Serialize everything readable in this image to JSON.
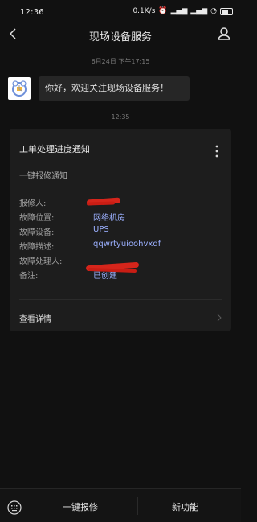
{
  "status_bar": {
    "time": "12:36",
    "network_speed": "0.1K/s",
    "icons": [
      "alarm-icon",
      "signal-icon",
      "signal-icon",
      "wifi-icon",
      "battery-icon"
    ]
  },
  "header": {
    "title": "现场设备服务",
    "back_icon": "back-icon",
    "profile_icon": "profile-icon"
  },
  "chat": {
    "timestamp1": "6月24日 下午17:15",
    "timestamp2": "12:35",
    "welcome": "你好，欢迎关注现场设备服务！"
  },
  "card": {
    "title": "工单处理进度通知",
    "subtitle": "一键报修通知",
    "fields": [
      {
        "label": "报修人:",
        "value": "",
        "redacted": true
      },
      {
        "label": "故障位置:",
        "value": "网络机房"
      },
      {
        "label": "故障设备:",
        "value": "UPS"
      },
      {
        "label": "故障描述:",
        "value": "qqwrtyuioohvxdf"
      },
      {
        "label": "故障处理人:",
        "value": "",
        "redacted": true
      },
      {
        "label": "备注:",
        "value": "已创建"
      }
    ],
    "details_link": "查看详情"
  },
  "bottom_menu": {
    "item1": "一键报修",
    "item2": "新功能",
    "keyboard_icon": "keyboard-icon"
  },
  "colors": {
    "background": "#111111",
    "card_background": "#1d1d1d",
    "link_blue": "#9bb0ff",
    "redaction_red": "#d5251b"
  }
}
